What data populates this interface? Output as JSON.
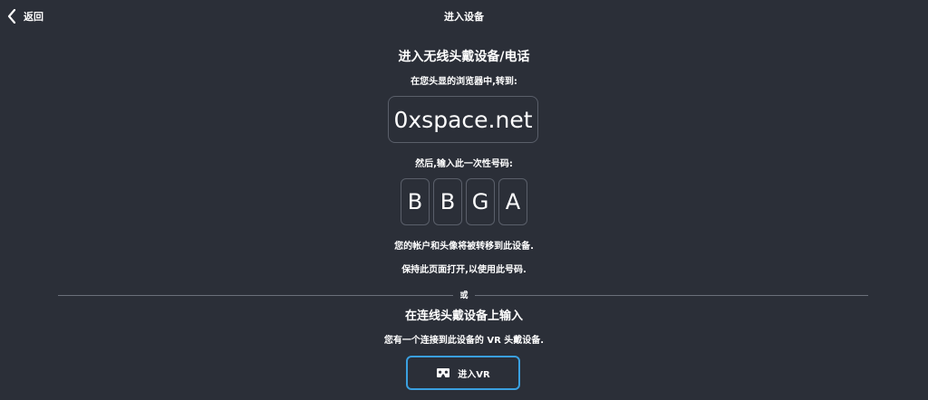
{
  "header": {
    "back_label": "返回",
    "title": "进入设备"
  },
  "main": {
    "heading": "进入无线头戴设备/电话",
    "instruction_browser": "在您头显的浏览器中,转到:",
    "url": "0xspace.net",
    "instruction_code": "然后,输入此一次性号码:",
    "code_chars": [
      "B",
      "B",
      "G",
      "A"
    ],
    "note_transfer": "您的帐户和头像将被转移到此设备.",
    "note_keep_open": "保持此页面打开,以使用此号码."
  },
  "divider": {
    "or_label": "或"
  },
  "tethered": {
    "heading": "在连线头戴设备上输入",
    "description": "您有一个连接到此设备的 VR 头戴设备.",
    "button_label": "进入VR",
    "button_icon": "vr-headset-icon"
  },
  "colors": {
    "background": "#2b2f38",
    "accent_border": "#3aa0e0",
    "box_border": "#5a5f6a"
  }
}
